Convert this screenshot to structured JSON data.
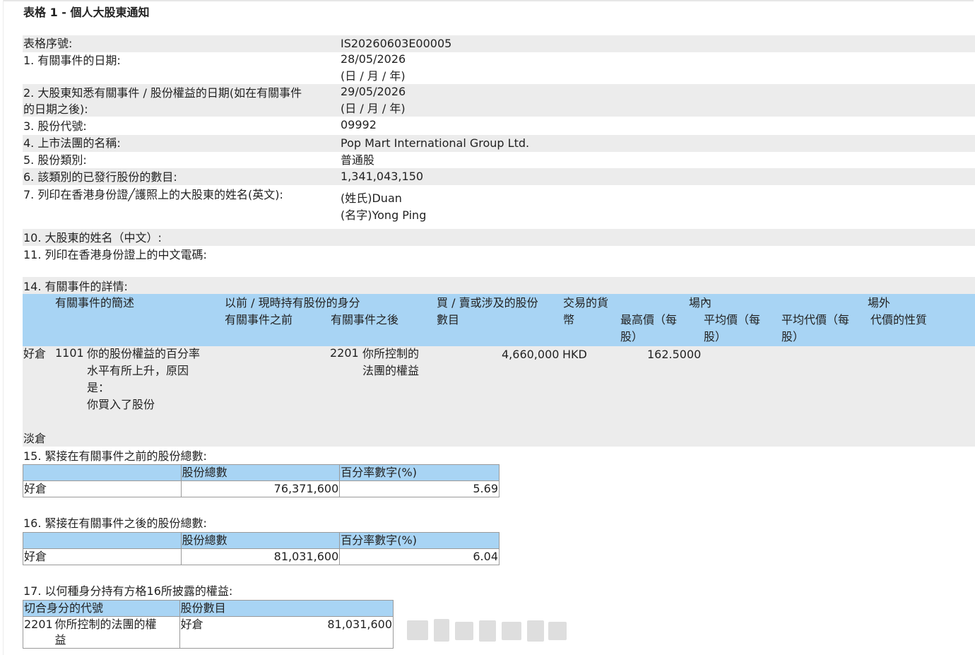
{
  "title": "表格 1 - 個人大股東通知",
  "fields": {
    "serial_label": "表格序號:",
    "serial_value": "IS20260603E00005",
    "f1_label": "1. 有關事件的日期:",
    "f1_value": "28/05/2026",
    "f1_format": "(日 / 月 / 年)",
    "f2_label_line1": "2. 大股東知悉有關事件 / 股份權益的日期(如在有關事件",
    "f2_label_line2": "的日期之後):",
    "f2_value": "29/05/2026",
    "f2_format": "(日 / 月 / 年)",
    "f3_label": "3. 股份代號:",
    "f3_value": "09992",
    "f4_label": "4. 上市法團的名稱:",
    "f4_value": "Pop Mart International Group Ltd.",
    "f5_label": "5. 股份類別:",
    "f5_value": "普通股",
    "f6_label": "6. 該類別的已發行股份的數目:",
    "f6_value": "1,341,043,150",
    "f7_label": "7. 列印在香港身份證╱護照上的大股東的姓名(英文):",
    "f7_surname": "(姓氏)Duan",
    "f7_given": "(名字)Yong Ping",
    "f10_label": "10. 大股東的姓名（中文）:",
    "f11_label": "11. 列印在香港身份證上的中文電碼:",
    "f14_label": "14. 有關事件的詳情:"
  },
  "event_table": {
    "h_desc": "有關事件的簡述",
    "h_capacity": "以前 / 現時持有股份的身分",
    "h_before": "有關事件之前",
    "h_after": "有關事件之後",
    "h_shares_1": "買 / 賣或涉及的股份",
    "h_shares_2": "數目",
    "h_currency_1": "交易的貨",
    "h_currency_2": "幣",
    "h_onexch": "場內",
    "h_high_1": "最高價（每",
    "h_high_2": "股）",
    "h_avg_1": "平均價（每",
    "h_avg_2": "股）",
    "h_offexch": "場外",
    "h_avgcons_1": "平均代價（每",
    "h_avgcons_2": "股）",
    "h_nature": "代價的性質",
    "row_position": "好倉",
    "row_code": "1101",
    "row_desc_1": "你的股份權益的百分率",
    "row_desc_2": "水平有所上升，原因",
    "row_desc_3": "是：",
    "row_desc_4": "你買入了股份",
    "row_after_code": "2201",
    "row_after_1": "你所控制的",
    "row_after_2": "法團的權益",
    "row_shares": "4,660,000",
    "row_currency": "HKD",
    "row_high": "162.5000",
    "short_label": "淡倉"
  },
  "f15": {
    "label": "15. 緊接在有關事件之前的股份總數:",
    "h_total": "股份總數",
    "h_pct": "百分率數字(%)",
    "row_label": "好倉",
    "row_total": "76,371,600",
    "row_pct": "5.69"
  },
  "f16": {
    "label": "16. 緊接在有關事件之後的股份總數:",
    "h_total": "股份總數",
    "h_pct": "百分率數字(%)",
    "row_label": "好倉",
    "row_total": "81,031,600",
    "row_pct": "6.04"
  },
  "f17": {
    "label": "17. 以何種身分持有方格16所披露的權益:",
    "h_code": "切合身分的代號",
    "h_shares": "股份數目",
    "row_code": "2201",
    "row_desc_1": "你所控制的法團的權",
    "row_desc_2": "益",
    "row_position": "好倉",
    "row_shares": "81,031,600"
  }
}
